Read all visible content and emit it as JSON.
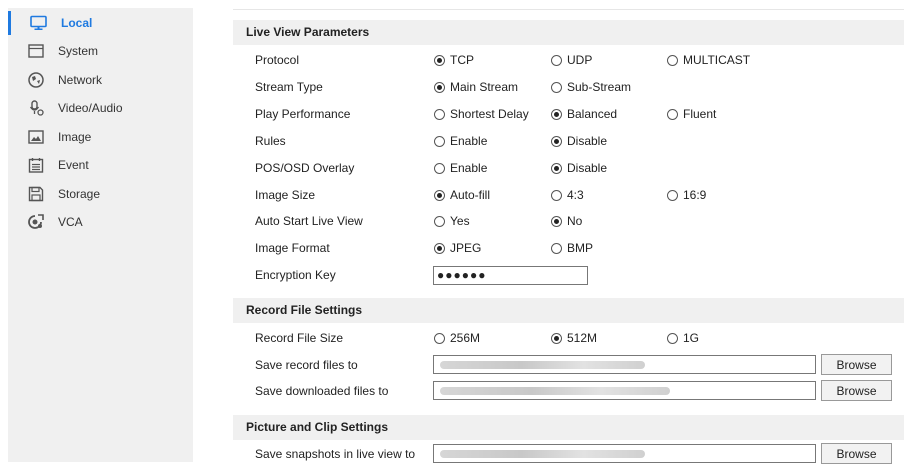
{
  "sidebar": {
    "items": [
      {
        "label": "Local",
        "icon": "monitor-icon",
        "active": true
      },
      {
        "label": "System",
        "icon": "system-icon"
      },
      {
        "label": "Network",
        "icon": "globe-icon"
      },
      {
        "label": "Video/Audio",
        "icon": "microphone-icon"
      },
      {
        "label": "Image",
        "icon": "image-icon"
      },
      {
        "label": "Event",
        "icon": "calendar-icon"
      },
      {
        "label": "Storage",
        "icon": "floppy-icon"
      },
      {
        "label": "VCA",
        "icon": "vca-icon"
      }
    ]
  },
  "live_view": {
    "title": "Live View Parameters",
    "protocol": {
      "label": "Protocol",
      "options": [
        "TCP",
        "UDP",
        "MULTICAST"
      ],
      "selected": "TCP"
    },
    "stream_type": {
      "label": "Stream Type",
      "options": [
        "Main Stream",
        "Sub-Stream"
      ],
      "selected": "Main Stream"
    },
    "play_performance": {
      "label": "Play Performance",
      "options": [
        "Shortest Delay",
        "Balanced",
        "Fluent"
      ],
      "selected": "Balanced"
    },
    "rules": {
      "label": "Rules",
      "options": [
        "Enable",
        "Disable"
      ],
      "selected": "Disable"
    },
    "pos_osd": {
      "label": "POS/OSD Overlay",
      "options": [
        "Enable",
        "Disable"
      ],
      "selected": "Disable"
    },
    "image_size": {
      "label": "Image Size",
      "options": [
        "Auto-fill",
        "4:3",
        "16:9"
      ],
      "selected": "Auto-fill"
    },
    "auto_start": {
      "label": "Auto Start Live View",
      "options": [
        "Yes",
        "No"
      ],
      "selected": "No"
    },
    "image_format": {
      "label": "Image Format",
      "options": [
        "JPEG",
        "BMP"
      ],
      "selected": "JPEG"
    },
    "encryption_key": {
      "label": "Encryption Key",
      "value": "●●●●●●"
    }
  },
  "record_file": {
    "title": "Record File Settings",
    "size": {
      "label": "Record File Size",
      "options": [
        "256M",
        "512M",
        "1G"
      ],
      "selected": "512M"
    },
    "save_record": {
      "label": "Save record files to",
      "button": "Browse"
    },
    "save_downloaded": {
      "label": "Save downloaded files to",
      "button": "Browse"
    }
  },
  "picture_clip": {
    "title": "Picture and Clip Settings",
    "save_snapshots": {
      "label": "Save snapshots in live view to",
      "button": "Browse"
    }
  },
  "colors": {
    "accent": "#1f7ae0",
    "section_bg": "#f0f0f0",
    "sidebar_bg": "#f0f0f0"
  }
}
